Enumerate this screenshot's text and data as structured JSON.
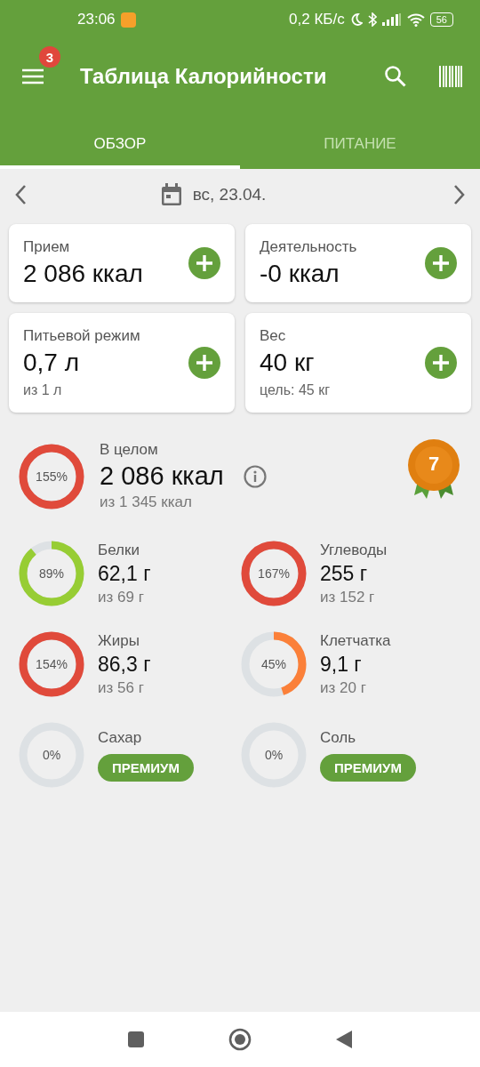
{
  "status_bar": {
    "time": "23:06",
    "speed": "0,2 КБ/с",
    "battery": "56"
  },
  "app_bar": {
    "title": "Таблица Калорийности",
    "badge": "3"
  },
  "tabs": [
    {
      "label": "ОБЗОР",
      "selected": true
    },
    {
      "label": "ПИТАНИЕ",
      "selected": false
    }
  ],
  "date": "вс, 23.04.",
  "cards": [
    {
      "label": "Прием",
      "value": "2 086 ккал"
    },
    {
      "label": "Деятельность",
      "value": "-0 ккал"
    },
    {
      "label": "Питьевой режим",
      "value": "0,7 л",
      "sub": "из 1 л"
    },
    {
      "label": "Вес",
      "value": "40 кг",
      "sub": "цель: 45 кг"
    }
  ],
  "overall": {
    "label": "В целом",
    "value": "2 086 ккал",
    "sub": "из 1 345 ккал",
    "percent": "155%",
    "level": 1,
    "color": "#e04a3b",
    "award": "7"
  },
  "nutrients": [
    {
      "kind": "value",
      "label": "Белки",
      "value": "62,1 г",
      "sub": "из 69 г",
      "percent": "89%",
      "level": 0.89,
      "color": "#97cd34"
    },
    {
      "kind": "value",
      "label": "Углеводы",
      "value": "255 г",
      "sub": "из 152 г",
      "percent": "167%",
      "level": 1,
      "color": "#e04a3b"
    },
    {
      "kind": "value",
      "label": "Жиры",
      "value": "86,3 г",
      "sub": "из 56 г",
      "percent": "154%",
      "level": 1,
      "color": "#e04a3b"
    },
    {
      "kind": "value",
      "label": "Клетчатка",
      "value": "9,1 г",
      "sub": "из 20 г",
      "percent": "45%",
      "level": 0.45,
      "color": "#fb8039"
    },
    {
      "kind": "premium",
      "label": "Сахар",
      "button": "ПРЕМИУМ",
      "percent": "0%"
    },
    {
      "kind": "premium",
      "label": "Соль",
      "button": "ПРЕМИУМ",
      "percent": "0%"
    }
  ]
}
